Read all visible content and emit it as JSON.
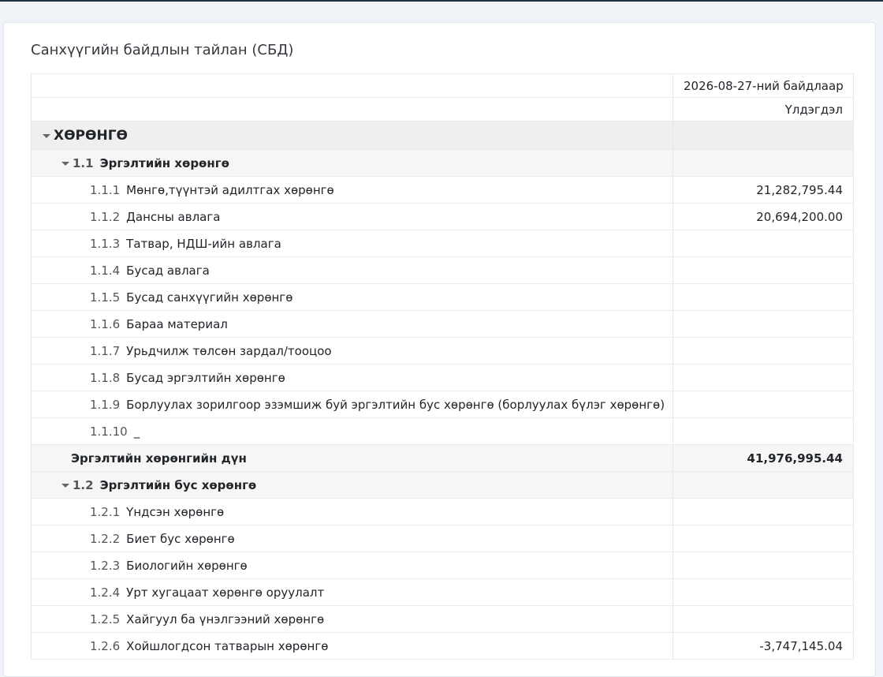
{
  "title": "Санхүүгийн байдлын тайлан (СБД)",
  "columns": {
    "date_header": "2026-08-27-ний байдлаар",
    "balance_header": "Үлдэгдэл"
  },
  "section": {
    "label": "ХӨРӨНГӨ"
  },
  "group1": {
    "code": "1.1",
    "label": "Эргэлтийн хөрөнгө",
    "rows": [
      {
        "code": "1.1.1",
        "label": "Мөнгө,түүнтэй адилтгах хөрөнгө",
        "value": "21,282,795.44"
      },
      {
        "code": "1.1.2",
        "label": "Дансны авлага",
        "value": "20,694,200.00"
      },
      {
        "code": "1.1.3",
        "label": "Татвар, НДШ-ийн авлага",
        "value": ""
      },
      {
        "code": "1.1.4",
        "label": "Бусад авлага",
        "value": ""
      },
      {
        "code": "1.1.5",
        "label": "Бусад санхүүгийн хөрөнгө",
        "value": ""
      },
      {
        "code": "1.1.6",
        "label": "Бараа материал",
        "value": ""
      },
      {
        "code": "1.1.7",
        "label": "Урьдчилж төлсөн зардал/тооцоо",
        "value": ""
      },
      {
        "code": "1.1.8",
        "label": "Бусад эргэлтийн хөрөнгө",
        "value": ""
      },
      {
        "code": "1.1.9",
        "label": "Борлуулах зорилгоор эзэмшиж буй эргэлтийн бус хөрөнгө (борлуулах бүлэг хөрөнгө)",
        "value": ""
      },
      {
        "code": "1.1.10",
        "label": "_",
        "value": ""
      }
    ],
    "total_label": "Эргэлтийн хөрөнгийн дүн",
    "total_value": "41,976,995.44"
  },
  "group2": {
    "code": "1.2",
    "label": "Эргэлтийн бус хөрөнгө",
    "rows": [
      {
        "code": "1.2.1",
        "label": "Үндсэн хөрөнгө",
        "value": ""
      },
      {
        "code": "1.2.2",
        "label": "Биет бус хөрөнгө",
        "value": ""
      },
      {
        "code": "1.2.3",
        "label": "Биологийн хөрөнгө",
        "value": ""
      },
      {
        "code": "1.2.4",
        "label": "Урт хугацаат хөрөнгө оруулалт",
        "value": ""
      },
      {
        "code": "1.2.5",
        "label": "Хайгуул ба үнэлгээний хөрөнгө",
        "value": ""
      },
      {
        "code": "1.2.6",
        "label": "Хойшлогдсон татварын хөрөнгө",
        "value": "-3,747,145.04"
      }
    ]
  }
}
